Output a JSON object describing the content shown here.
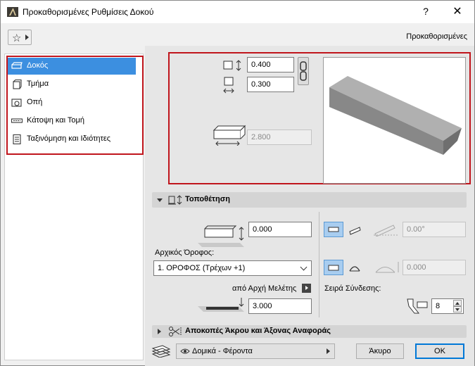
{
  "window": {
    "title": "Προκαθορισμένες Ρυθμίσεις Δοκού",
    "help": "?",
    "close": "✕"
  },
  "header": {
    "preset_label": "Προκαθορισμένες"
  },
  "nav": {
    "items": [
      {
        "label": "Δοκός",
        "icon": "beam-icon",
        "selected": true
      },
      {
        "label": "Τμήμα",
        "icon": "segment-icon",
        "selected": false
      },
      {
        "label": "Οπή",
        "icon": "hole-icon",
        "selected": false
      },
      {
        "label": "Κάτοψη και Τομή",
        "icon": "floorplan-section-icon",
        "selected": false
      },
      {
        "label": "Ταξινόμηση και Ιδιότητες",
        "icon": "classification-icon",
        "selected": false
      }
    ]
  },
  "geometry": {
    "height": "0.400",
    "width": "0.300",
    "length": "2.800"
  },
  "placement": {
    "section_title": "Τοποθέτηση",
    "offset": "0.000",
    "home_story_label": "Αρχικός Όροφος:",
    "home_story_value": "1. ΟΡΟΦΟΣ (Τρέχων +1)",
    "from_project_zero_label": "από Αρχή Μελέτης",
    "elevation": "3.000",
    "slant_angle": "0.00°",
    "arc_value": "0.000",
    "connection_order_label": "Σειρά Σύνδεσης:",
    "connection_order_value": "8"
  },
  "end_cuts": {
    "section_title": "Αποκοπές Άκρου και Άξονας Αναφοράς"
  },
  "footer": {
    "layer_value": "Δομικά - Φέροντα",
    "cancel_label": "Άκυρο",
    "ok_label": "OK"
  },
  "colors": {
    "highlight": "#c0151c",
    "selection": "#3c8fe0"
  }
}
